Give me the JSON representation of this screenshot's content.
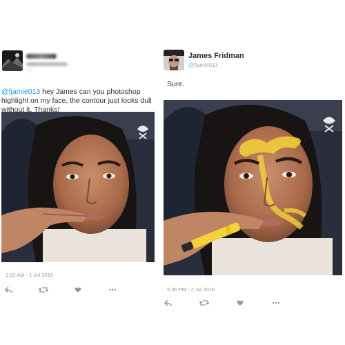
{
  "left_tweet": {
    "handle": "@jc",
    "mention": "@fjamie013",
    "text_rest": " hey James can you photoshop highlight on my face, the contour just looks dull without it. Thanks!",
    "timestamp": "1:02 AM - 1 Jul 2016",
    "photo_icon": "selfie-photo",
    "actions": [
      "reply-icon",
      "retweet-icon",
      "like-icon",
      "more-icon"
    ]
  },
  "right_tweet": {
    "display_name": "James Fridman",
    "handle": "@fjamie013",
    "text": "Sure.",
    "timestamp": "5:36 PM - 2 Jul 2016",
    "photo_icon": "edited-selfie-photo-with-highlighter",
    "actions": [
      "reply-icon",
      "retweet-icon",
      "like-icon",
      "more-icon"
    ]
  },
  "colors": {
    "mention": "#1b95e0",
    "text": "#292f33",
    "meta": "#8899a6",
    "highlighter": "#f4d23a"
  }
}
